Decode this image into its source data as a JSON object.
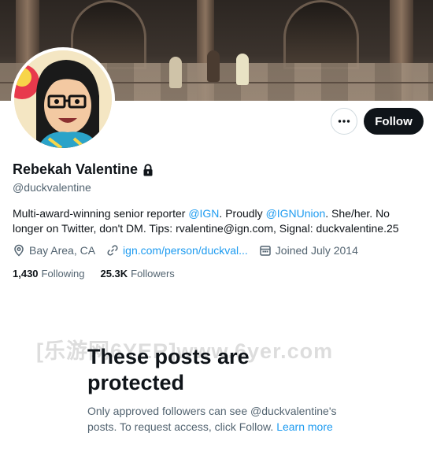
{
  "profile": {
    "name": "Rebekah Valentine",
    "handle": "@duckvalentine",
    "bio_parts": {
      "p1": "Multi-award-winning senior reporter ",
      "m1": "@IGN",
      "p2": ". Proudly ",
      "m2": "@IGNUnion",
      "p3": ". She/her. No longer on Twitter, don't DM. Tips: rvalentine@ign.com, Signal: duckvalentine.25"
    },
    "location": "Bay Area, CA",
    "website": "ign.com/person/duckval...",
    "joined": "Joined July 2014",
    "following_count": "1,430",
    "following_label": "Following",
    "followers_count": "25.3K",
    "followers_label": "Followers",
    "lock_icon": "lock-icon"
  },
  "actions": {
    "more_icon": "more-dots-icon",
    "follow_label": "Follow"
  },
  "protected": {
    "title": "These posts are protected",
    "desc": "Only approved followers can see @duckvalentine's posts. To request access, click Follow. ",
    "learn_more": "Learn more"
  },
  "watermark": "[乐游网6YER]www.6yer.com",
  "icons": {
    "location": "location-pin-icon",
    "link": "link-icon",
    "calendar": "calendar-icon"
  },
  "colors": {
    "accent": "#1d9bf0",
    "text": "#0f1419",
    "muted": "#536471",
    "follow_bg": "#0f1419"
  }
}
